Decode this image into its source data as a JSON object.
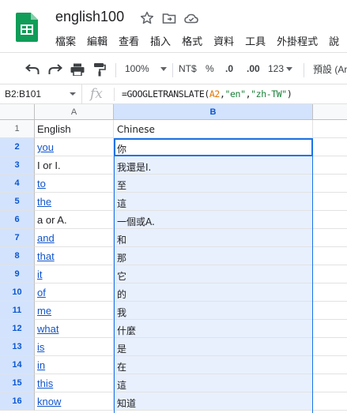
{
  "doc": {
    "title": "english100"
  },
  "menu": [
    "檔案",
    "編輯",
    "查看",
    "插入",
    "格式",
    "資料",
    "工具",
    "外掛程式",
    "說"
  ],
  "toolbar": {
    "zoom": "100%",
    "currency": "NT$",
    "percent": "%",
    "dec_decrease": ".0",
    "dec_increase": ".00",
    "more_formats": "123",
    "font": "預設 (Ari"
  },
  "formula_bar": {
    "name_box": "B2:B101",
    "fx": "fx",
    "formula_prefix": "=GOOGLETRANSLATE(",
    "formula_ref": "A2",
    "formula_comma1": ",",
    "formula_src": "\"en\"",
    "formula_comma2": ",",
    "formula_dst": "\"zh-TW\"",
    "formula_suffix": ")"
  },
  "grid": {
    "columns": [
      "A",
      "B"
    ],
    "rows": [
      {
        "n": "1",
        "a": "English",
        "b": "Chinese"
      },
      {
        "n": "2",
        "a": "you",
        "b": "你"
      },
      {
        "n": "3",
        "a": "I or I.",
        "b": "我還是I."
      },
      {
        "n": "4",
        "a": "to",
        "b": "至"
      },
      {
        "n": "5",
        "a": "the",
        "b": "這"
      },
      {
        "n": "6",
        "a": "a or A.",
        "b": "一個或A."
      },
      {
        "n": "7",
        "a": "and",
        "b": "和"
      },
      {
        "n": "8",
        "a": "that",
        "b": "那"
      },
      {
        "n": "9",
        "a": "it",
        "b": "它"
      },
      {
        "n": "10",
        "a": "of",
        "b": "的"
      },
      {
        "n": "11",
        "a": "me",
        "b": "我"
      },
      {
        "n": "12",
        "a": "what",
        "b": "什麼"
      },
      {
        "n": "13",
        "a": "is",
        "b": "是"
      },
      {
        "n": "14",
        "a": "in",
        "b": "在"
      },
      {
        "n": "15",
        "a": "this",
        "b": "這"
      },
      {
        "n": "16",
        "a": "know",
        "b": "知道"
      }
    ]
  },
  "colors": {
    "brand": "#0f9d58",
    "selection": "#1a73e8",
    "link": "#1155cc"
  }
}
